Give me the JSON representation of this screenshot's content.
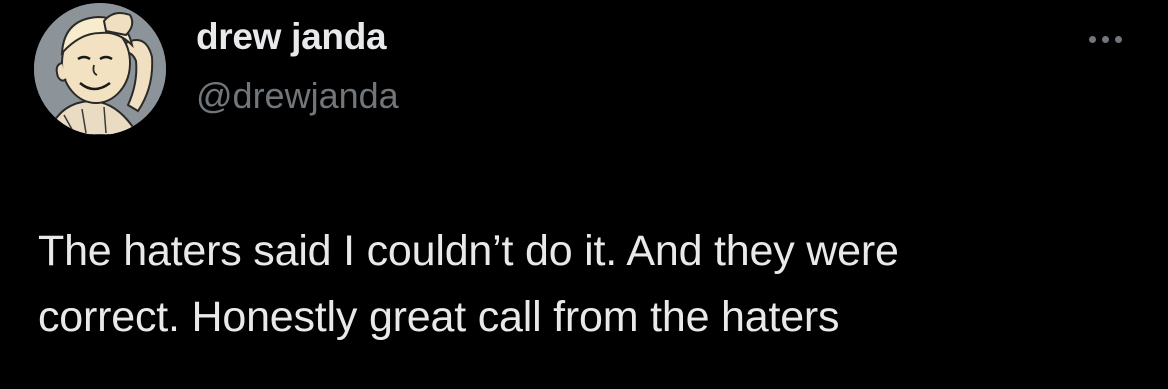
{
  "tweet": {
    "author": {
      "display_name": "drew janda",
      "handle": "@drewjanda",
      "avatar_icon": "cartoon-boy-avatar"
    },
    "more_icon": "more-horizontal-icon",
    "text_lines": [
      "The haters said I couldn’t do it. And they were",
      "correct. Honestly great call from the haters"
    ]
  },
  "colors": {
    "background": "#000000",
    "primary_text": "#e7e9ea",
    "secondary_text": "#71767b"
  }
}
